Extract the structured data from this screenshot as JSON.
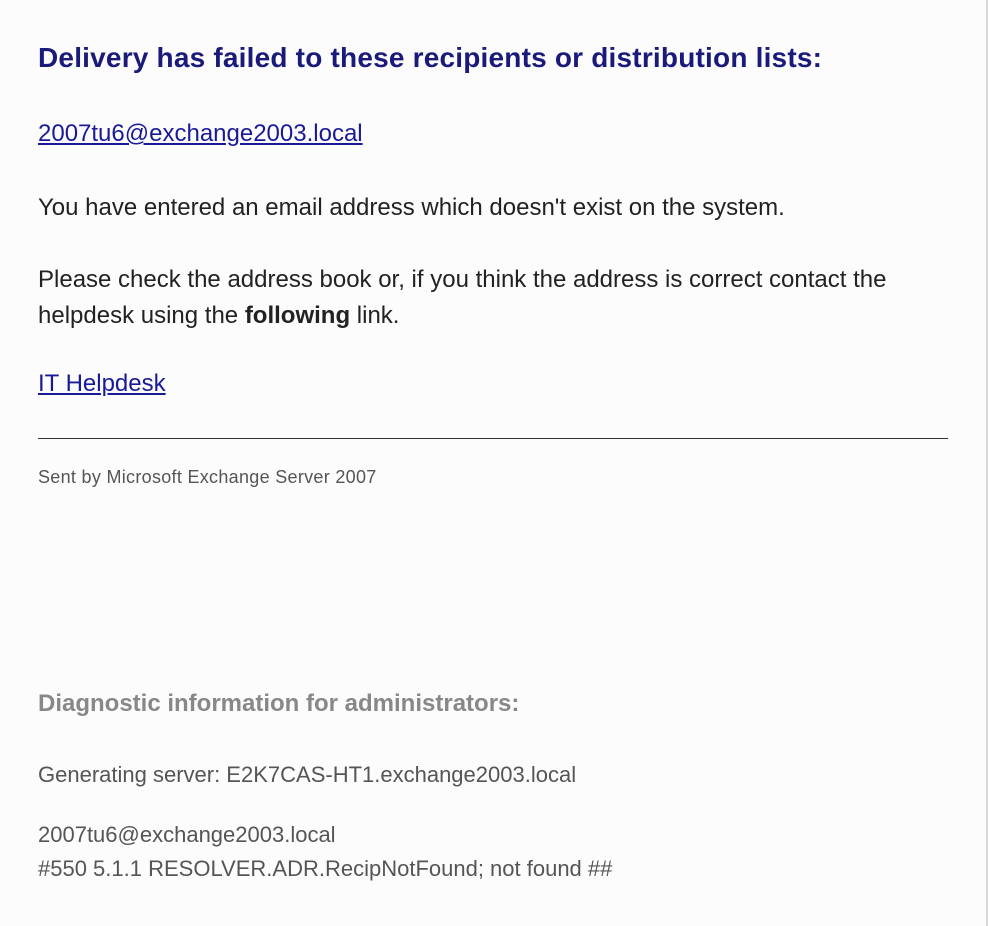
{
  "message": {
    "headline": "Delivery has failed to these recipients or distribution lists:",
    "recipient_link": "2007tu6@exchange2003.local",
    "para1": "You have entered an email address which doesn't exist on the system.",
    "para2_pre": "Please check the address book or, if you think the address is correct contact the helpdesk using the ",
    "para2_bold": "following",
    "para2_post": " link.",
    "helpdesk_link": "IT Helpdesk",
    "sent_by": "Sent by Microsoft Exchange Server 2007"
  },
  "diagnostics": {
    "heading": "Diagnostic information for administrators:",
    "generating_server": "Generating server: E2K7CAS-HT1.exchange2003.local",
    "recipient": "2007tu6@exchange2003.local",
    "error_line": "#550 5.1.1 RESOLVER.ADR.RecipNotFound; not found ##"
  }
}
